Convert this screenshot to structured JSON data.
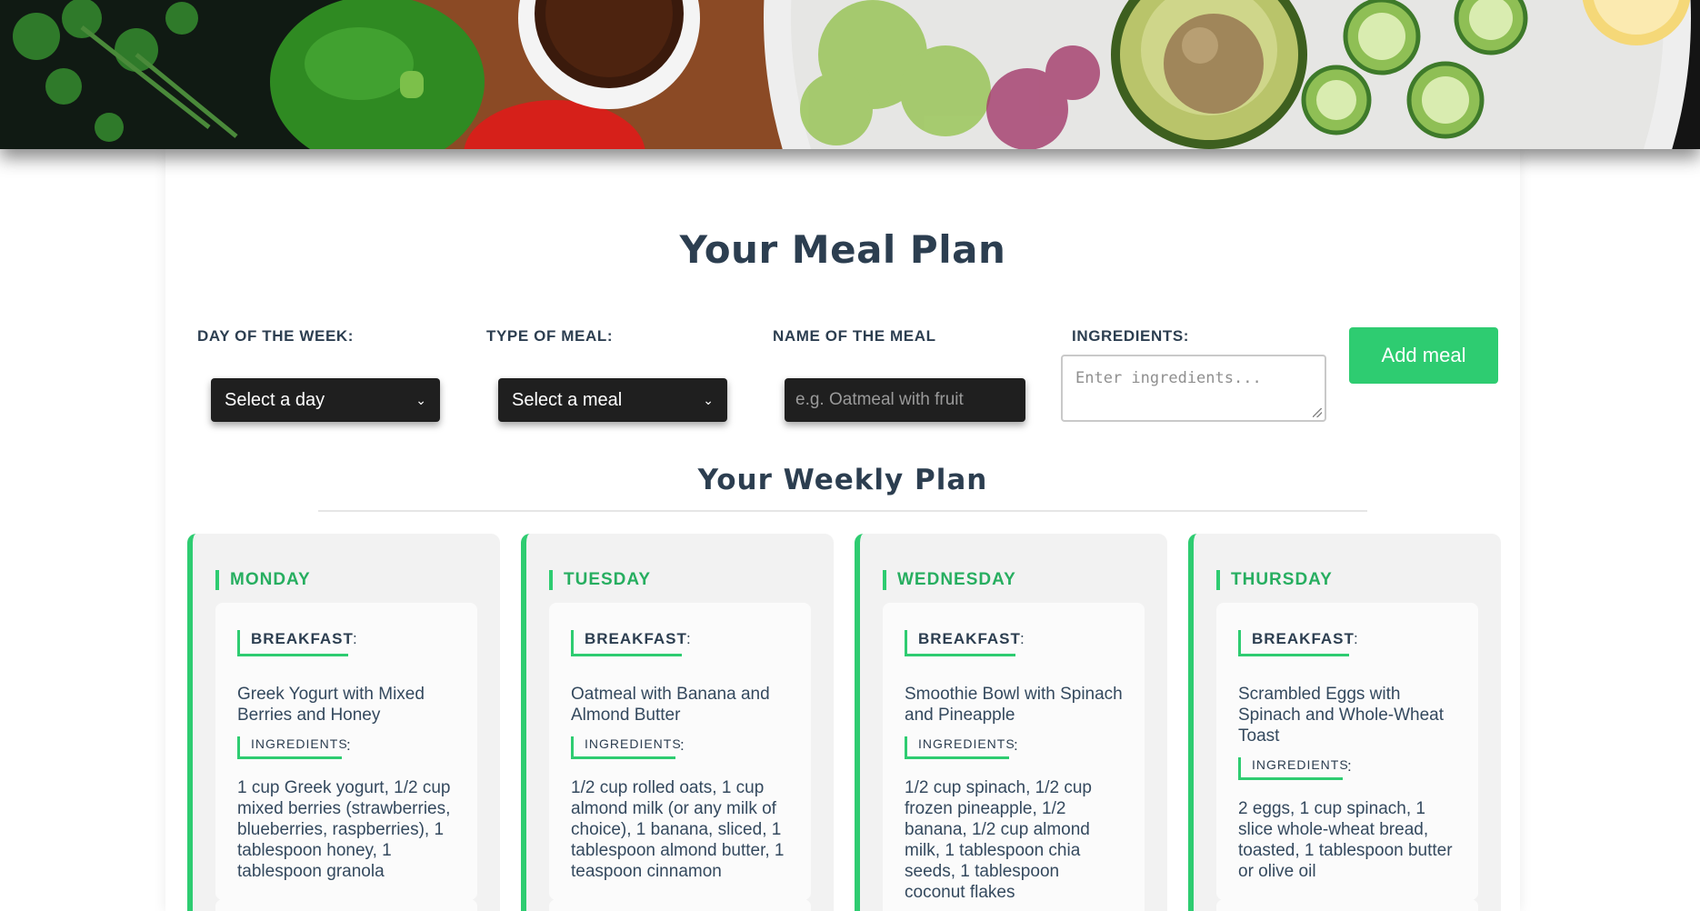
{
  "hero": {
    "image_description_icon": "vegetables-banner-image"
  },
  "page_title": "Your Meal Plan",
  "form": {
    "day_label": "DAY OF THE WEEK:",
    "day_value": "Select a day",
    "meal_type_label": "TYPE OF MEAL:",
    "meal_type_value": "Select a meal",
    "meal_name_label": "NAME OF THE MEAL",
    "meal_name_placeholder": "e.g. Oatmeal with fruit",
    "ingredients_label": "INGREDIENTS:",
    "ingredients_placeholder": "Enter ingredients...",
    "add_button": "Add meal"
  },
  "weekly": {
    "title": "Your Weekly Plan",
    "colon": ":",
    "days": [
      {
        "name": "MONDAY",
        "meals": [
          {
            "type": "BREAKFAST",
            "name": "Greek Yogurt with Mixed Berries and Honey",
            "ingredients_label": "INGREDIENTS",
            "ingredients": "1 cup Greek yogurt, 1/2 cup mixed berries (strawberries, blueberries, raspberries), 1 tablespoon honey, 1 tablespoon granola"
          }
        ]
      },
      {
        "name": "TUESDAY",
        "meals": [
          {
            "type": "BREAKFAST",
            "name": "Oatmeal with Banana and Almond Butter",
            "ingredients_label": "INGREDIENTS",
            "ingredients": "1/2 cup rolled oats, 1 cup almond milk (or any milk of choice), 1 banana, sliced, 1 tablespoon almond butter, 1 teaspoon cinnamon"
          }
        ]
      },
      {
        "name": "WEDNESDAY",
        "meals": [
          {
            "type": "BREAKFAST",
            "name": "Smoothie Bowl with Spinach and Pineapple",
            "ingredients_label": "INGREDIENTS",
            "ingredients": "1/2 cup spinach, 1/2 cup frozen pineapple, 1/2 banana, 1/2 cup almond milk, 1 tablespoon chia seeds, 1 tablespoon coconut flakes"
          }
        ]
      },
      {
        "name": "THURSDAY",
        "meals": [
          {
            "type": "BREAKFAST",
            "name": "Scrambled Eggs with Spinach and Whole-Wheat Toast",
            "ingredients_label": "INGREDIENTS",
            "ingredients": "2 eggs, 1 cup spinach, 1 slice whole-wheat bread, toasted, 1 tablespoon butter or olive oil"
          }
        ]
      }
    ]
  },
  "colors": {
    "accent": "#2ecc71",
    "accent_dark": "#27ae60",
    "heading": "#2c3e50",
    "input_bg": "#1f1f1f"
  }
}
